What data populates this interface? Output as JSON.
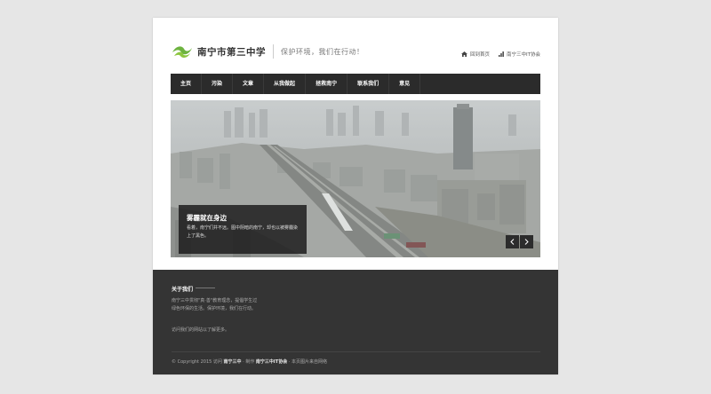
{
  "header": {
    "site_name": "南宁市第三中学",
    "slogan": "保护环境，我们在行动！",
    "links": [
      {
        "label": "回到首页",
        "icon": "home-icon"
      },
      {
        "label": "南宁三中IT协会",
        "icon": "signal-icon"
      }
    ]
  },
  "nav": {
    "items": [
      "主页",
      "污染",
      "文章",
      "从我做起",
      "拯救南宁",
      "联系我们",
      "意见"
    ]
  },
  "hero": {
    "title": "雾霾就在身边",
    "description": "看着，南宁们并不远。图中阴暗的南宁，却也以被雾霾染上了黑色。"
  },
  "footer": {
    "about_title": "关于我们",
    "about_text": "南宁三中贯彻\"真·善\"教育理念，提倡学生过绿色环保的生活。保护环境，我们在行动。",
    "about_more": "访问我们的网站以了解更多。",
    "copyright_prefix": "© Copyright 2015 访问",
    "copyright_school": "南宁三中",
    "copyright_mid": "· 制作",
    "copyright_org": "南宁三中IT协会",
    "copyright_suffix": "· 本页图片来自网络"
  },
  "colors": {
    "logo_green": "#6db33f",
    "nav_bg": "#2b2b2b",
    "footer_bg": "#343434",
    "page_bg": "#e6e6e6"
  }
}
